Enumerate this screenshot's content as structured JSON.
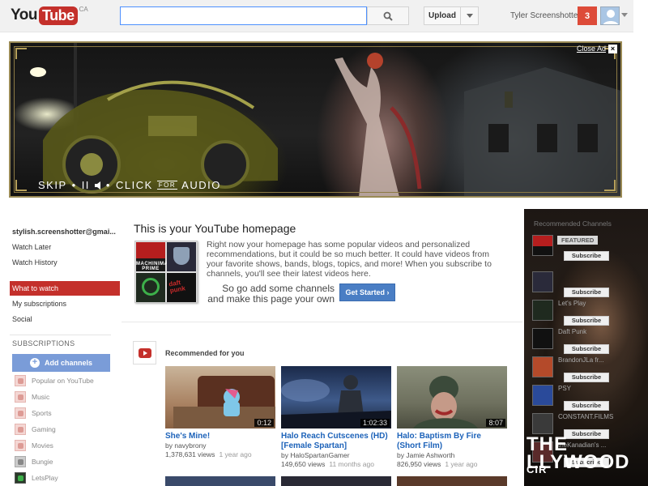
{
  "header": {
    "logo_you": "You",
    "logo_tube": "Tube",
    "logo_country": "CA",
    "search_value": "",
    "upload_label": "Upload",
    "username": "Tyler Screenshotter",
    "notification_count": "3"
  },
  "ad": {
    "close_label": "Close Ad",
    "close_icon": "×",
    "skip_label": "SKIP",
    "pause_symbol": "II",
    "click_label": "CLICK",
    "for_label": "FOR",
    "audio_label": "AUDIO"
  },
  "sidebar": {
    "account": "stylish.screenshotter@gmai...",
    "links": [
      "Watch Later",
      "Watch History"
    ],
    "active": "What to watch",
    "sections": [
      "My subscriptions",
      "Social"
    ],
    "subscriptions_header": "SUBSCRIPTIONS",
    "add_channels_label": "Add channels",
    "subscriptions": [
      "Popular on YouTube",
      "Music",
      "Sports",
      "Gaming",
      "Movies",
      "Bungie",
      "LetsPlay"
    ]
  },
  "intro": {
    "title": "This is your YouTube homepage",
    "body": "Right now your homepage has some popular videos and personalized recommendations, but it could be so much better. It could have videos from your favorite shows, bands, blogs, topics, and more! When you subscribe to channels, you'll see their latest videos here.",
    "cta": "So go add some channels and make this page your own",
    "button": "Get Started ›",
    "tile_machinima": "MACHINIMA PRIME",
    "tile_daftpunk": "daft punk"
  },
  "recommended": {
    "title": "Recommended for you",
    "videos": [
      {
        "title": "She's Mine!",
        "author": "by navybrony",
        "views": "1,378,631 views",
        "ago": "1 year ago",
        "duration": "0:12"
      },
      {
        "title": "Halo Reach Cutscenes (HD) [Female Spartan]",
        "author": "by HaloSpartanGamer",
        "views": "149,650 views",
        "ago": "11 months ago",
        "duration": "1:02:33"
      },
      {
        "title": "Halo: Baptism By Fire (Short Film)",
        "author": "by Jamie Ashworth",
        "views": "826,950 views",
        "ago": "1 year ago",
        "duration": "8:07"
      }
    ]
  },
  "channels": {
    "header": "Recommended Channels",
    "featured_label": "FEATURED",
    "subscribe_label": "Subscribe",
    "items": [
      {
        "name": ""
      },
      {
        "name": ""
      },
      {
        "name": "Let's Play"
      },
      {
        "name": "Daft Punk"
      },
      {
        "name": "BrandonJLa fr..."
      },
      {
        "name": "PSY"
      },
      {
        "name": "CONSTANT.FILMS"
      },
      {
        "name": "theKanadian's ..."
      }
    ],
    "overlay_text_1": "THE",
    "overlay_text_2": "LLYWOOD",
    "overlay_text_3": "CIR"
  }
}
